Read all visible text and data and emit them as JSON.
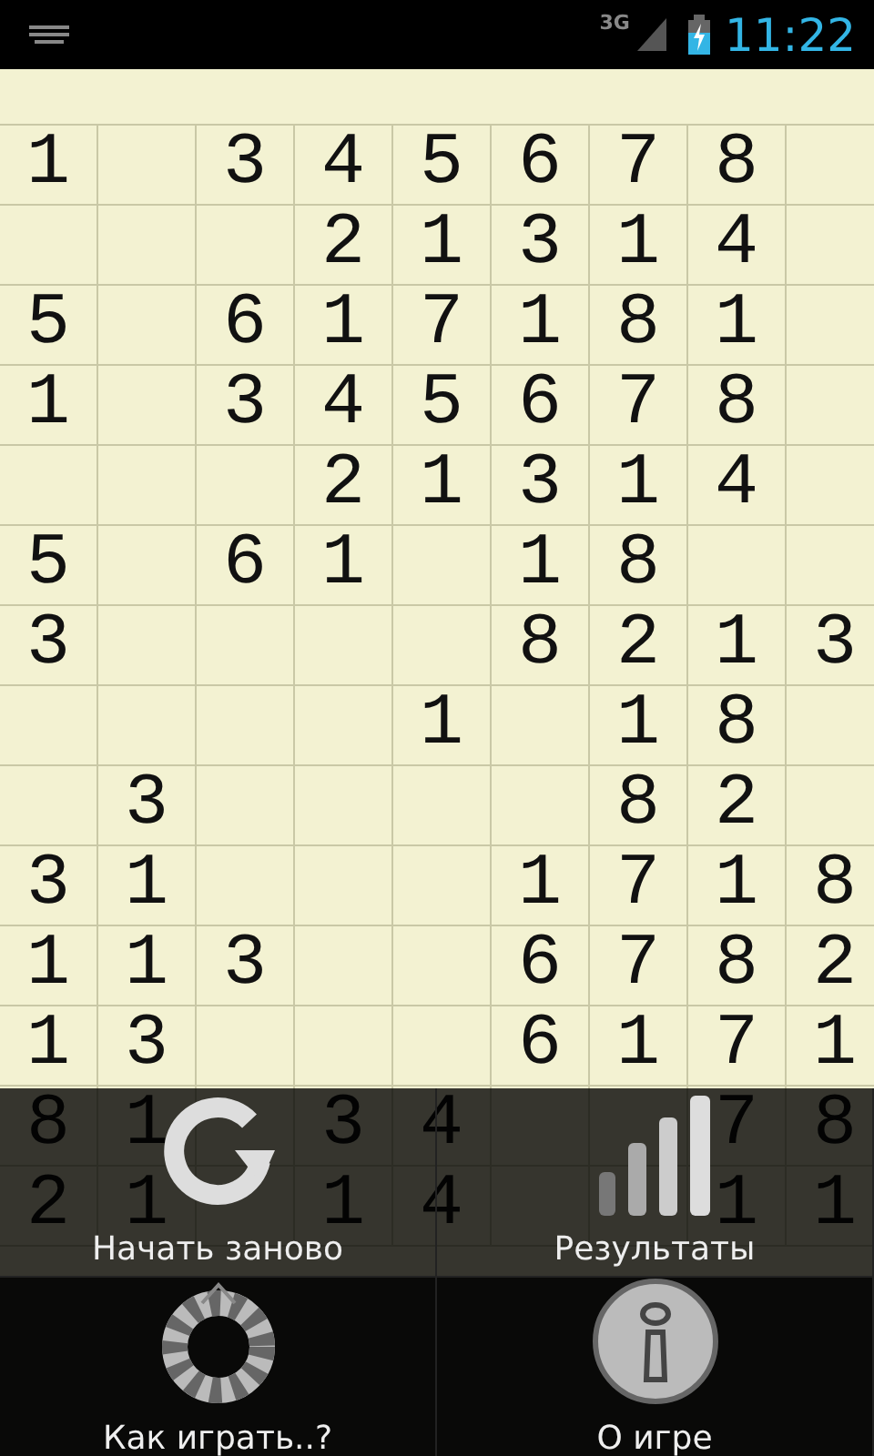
{
  "status_bar": {
    "network": "3G",
    "time": "11:22"
  },
  "grid": {
    "rows": [
      [
        "1",
        null,
        "3",
        "4",
        "5",
        "6",
        "7",
        "8",
        null
      ],
      [
        null,
        null,
        null,
        "2",
        "1",
        "3",
        "1",
        "4",
        null
      ],
      [
        "5",
        null,
        "6",
        "1",
        "7",
        "1",
        "8",
        "1",
        null
      ],
      [
        "1",
        null,
        "3",
        "4",
        "5",
        "6",
        "7",
        "8",
        null
      ],
      [
        null,
        null,
        null,
        "2",
        "1",
        "3",
        "1",
        "4",
        null
      ],
      [
        "5",
        null,
        "6",
        "1",
        null,
        "1",
        "8",
        null,
        null
      ],
      [
        "3",
        null,
        null,
        null,
        null,
        "8",
        "2",
        "1",
        "3"
      ],
      [
        null,
        null,
        null,
        null,
        "1",
        null,
        "1",
        "8",
        null
      ],
      [
        null,
        "3",
        null,
        null,
        null,
        null,
        "8",
        "2",
        null
      ],
      [
        "3",
        "1",
        null,
        null,
        null,
        "1",
        "7",
        "1",
        "8"
      ],
      [
        "1",
        "1",
        "3",
        null,
        null,
        "6",
        "7",
        "8",
        "2"
      ],
      [
        "1",
        "3",
        null,
        null,
        null,
        "6",
        "1",
        "7",
        "1"
      ],
      [
        "8",
        "1",
        null,
        "3",
        "4",
        null,
        null,
        "7",
        "8"
      ],
      [
        "2",
        "1",
        null,
        "1",
        "4",
        null,
        null,
        "1",
        "1"
      ]
    ]
  },
  "menu": {
    "items": [
      {
        "label": "Начать заново",
        "kind": "restart"
      },
      {
        "label": "Результаты",
        "kind": "results"
      },
      {
        "label": "Как играть..?",
        "kind": "help"
      },
      {
        "label": "О игре",
        "kind": "about"
      }
    ]
  }
}
